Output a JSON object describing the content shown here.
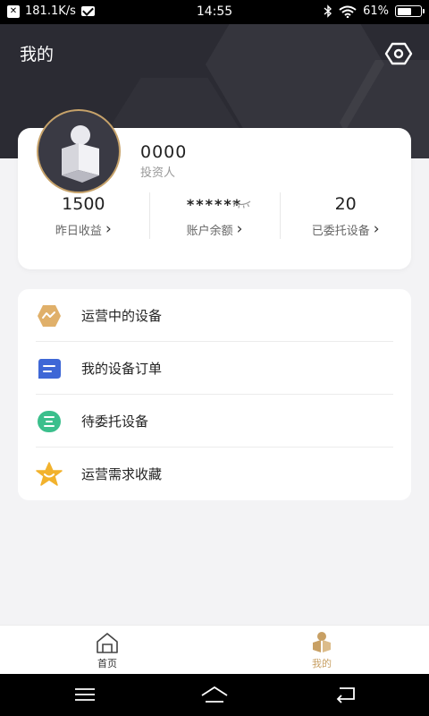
{
  "status_bar": {
    "net_speed": "181.1K/s",
    "time": "14:55",
    "battery_text": "61%",
    "battery_level": 0.61
  },
  "header": {
    "title": "我的"
  },
  "profile": {
    "name": "0000",
    "role": "投资人",
    "stats": [
      {
        "value": "1500",
        "label": "昨日收益"
      },
      {
        "value": "******",
        "label": "账户余额"
      },
      {
        "value": "20",
        "label": "已委托设备"
      }
    ]
  },
  "menu": {
    "items": [
      {
        "label": "运营中的设备",
        "icon": "chart-hexagon-icon",
        "color": "#e0b06a"
      },
      {
        "label": "我的设备订单",
        "icon": "order-list-icon",
        "color": "#3e67d6"
      },
      {
        "label": "待委托设备",
        "icon": "pending-device-icon",
        "color": "#3bbf8c"
      },
      {
        "label": "运营需求收藏",
        "icon": "star-icon",
        "color": "#f2b22d"
      }
    ]
  },
  "bottom_nav": {
    "tabs": [
      {
        "label": "首页",
        "icon": "home-icon",
        "active": false
      },
      {
        "label": "我的",
        "icon": "profile-icon",
        "active": true
      }
    ]
  },
  "colors": {
    "accent": "#c8a064",
    "header_bg": "#2b2b33"
  }
}
